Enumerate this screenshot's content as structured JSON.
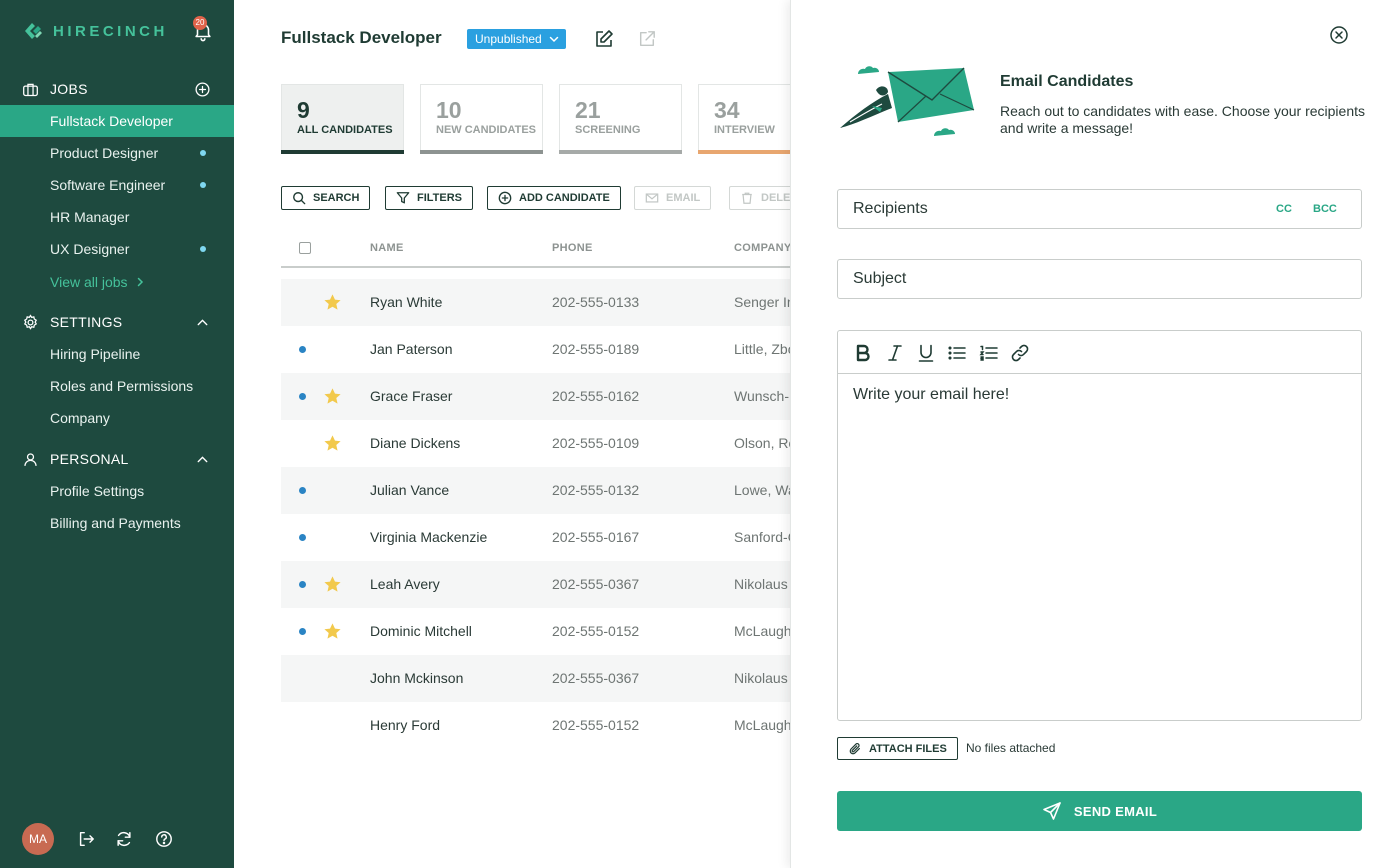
{
  "app": {
    "brand": "HIRECINCH",
    "notification_count": "20",
    "colors": {
      "sidebar": "#1e4a3f",
      "accent": "#2aa786",
      "status": "#2aa0e0",
      "dot": "#2a84c4",
      "star": "#f2c94c"
    }
  },
  "sidebar": {
    "jobs_label": "JOBS",
    "jobs": [
      {
        "label": "Fullstack Developer",
        "active": true,
        "dot": false
      },
      {
        "label": "Product Designer",
        "dot": true
      },
      {
        "label": "Software Engineer",
        "dot": true
      },
      {
        "label": "HR Manager",
        "dot": false
      },
      {
        "label": "UX Designer",
        "dot": true
      }
    ],
    "view_all": "View all jobs",
    "settings_label": "SETTINGS",
    "settings": [
      "Hiring Pipeline",
      "Roles and Permissions",
      "Company"
    ],
    "personal_label": "PERSONAL",
    "personal": [
      "Profile Settings",
      "Billing and Payments"
    ],
    "avatar_initials": "MA"
  },
  "main": {
    "job_title": "Fullstack Developer",
    "status": "Unpublished",
    "stats": [
      {
        "count": "9",
        "label": "ALL CANDIDATES",
        "bar": "#1f3b33",
        "active": true
      },
      {
        "count": "10",
        "label": "NEW CANDIDATES",
        "bar": "#8d9391"
      },
      {
        "count": "21",
        "label": "SCREENING",
        "bar": "#a6aaa8"
      },
      {
        "count": "34",
        "label": "INTERVIEW",
        "bar": "#e8a66f"
      }
    ],
    "toolbar": {
      "search": "SEARCH",
      "filters": "FILTERS",
      "add_candidate": "ADD CANDIDATE",
      "email": "EMAIL",
      "delete": "DELETE"
    },
    "table": {
      "headers": {
        "name": "NAME",
        "phone": "PHONE",
        "company": "COMPANY"
      },
      "rows": [
        {
          "name": "Ryan White",
          "phone": "202-555-0133",
          "company": "Senger Inc",
          "dot": false,
          "star": true
        },
        {
          "name": "Jan Paterson",
          "phone": "202-555-0189",
          "company": "Little, Zboncak",
          "dot": true,
          "star": false
        },
        {
          "name": "Grace Fraser",
          "phone": "202-555-0162",
          "company": "Wunsch-Kuhn",
          "dot": true,
          "star": true
        },
        {
          "name": "Diane Dickens",
          "phone": "202-555-0109",
          "company": "Olson, Rowe",
          "dot": false,
          "star": true
        },
        {
          "name": "Julian Vance",
          "phone": "202-555-0132",
          "company": "Lowe, Walker",
          "dot": true,
          "star": false
        },
        {
          "name": "Virginia Mackenzie",
          "phone": "202-555-0167",
          "company": "Sanford-Ondricka",
          "dot": true,
          "star": false
        },
        {
          "name": "Leah Avery",
          "phone": "202-555-0367",
          "company": "Nikolaus Group",
          "dot": true,
          "star": true
        },
        {
          "name": "Dominic Mitchell",
          "phone": "202-555-0152",
          "company": "McLaughlin LLC",
          "dot": true,
          "star": true
        },
        {
          "name": "John Mckinson",
          "phone": "202-555-0367",
          "company": "Nikolaus Group",
          "dot": false,
          "star": false
        },
        {
          "name": "Henry Ford",
          "phone": "202-555-0152",
          "company": "McLaughlin LLC",
          "dot": false,
          "star": false
        }
      ]
    }
  },
  "email_panel": {
    "title": "Email Candidates",
    "description": "Reach out to candidates with ease. Choose your recipients and write a message!",
    "recipients_placeholder": "Recipients",
    "cc": "CC",
    "bcc": "BCC",
    "subject_placeholder": "Subject",
    "body_placeholder": "Write your email here!",
    "toolbar_icons": [
      "bold-icon",
      "italic-icon",
      "underline-icon",
      "bullet-list-icon",
      "numbered-list-icon",
      "link-icon"
    ],
    "attach_label": "ATTACH FILES",
    "no_files": "No files attached",
    "send_label": "SEND EMAIL"
  }
}
